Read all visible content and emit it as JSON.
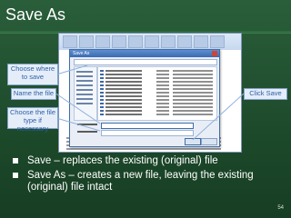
{
  "slide": {
    "title": "Save As",
    "page_number": "54"
  },
  "callouts": {
    "choose_where": "Choose where to save",
    "name_file": "Name the file",
    "choose_type": "Choose the file type if necessary",
    "click_save": "Click Save"
  },
  "bullets": [
    "Save –  replaces the existing (original) file",
    "Save As – creates a new file, leaving the existing (original) file intact"
  ],
  "dialog": {
    "title": "Save As"
  },
  "colors": {
    "slide_bg": "#1d4a2b",
    "callout_bg": "#e4edf8",
    "callout_text": "#2f5fa8",
    "title_text": "#ffffff"
  }
}
